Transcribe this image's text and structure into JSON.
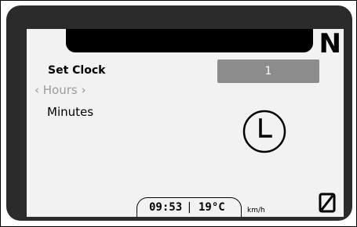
{
  "display": {
    "gear": "N",
    "menu": {
      "title": "Set Clock",
      "hours_item": "‹ Hours ›",
      "minutes_item": "Minutes"
    },
    "value_field": "1",
    "status": {
      "time": "09:53",
      "separator": "|",
      "temperature": "19°C",
      "speed_unit": "km/h"
    },
    "icons": {
      "clock": "clock-icon",
      "zero": "slashed-zero-icon"
    }
  }
}
